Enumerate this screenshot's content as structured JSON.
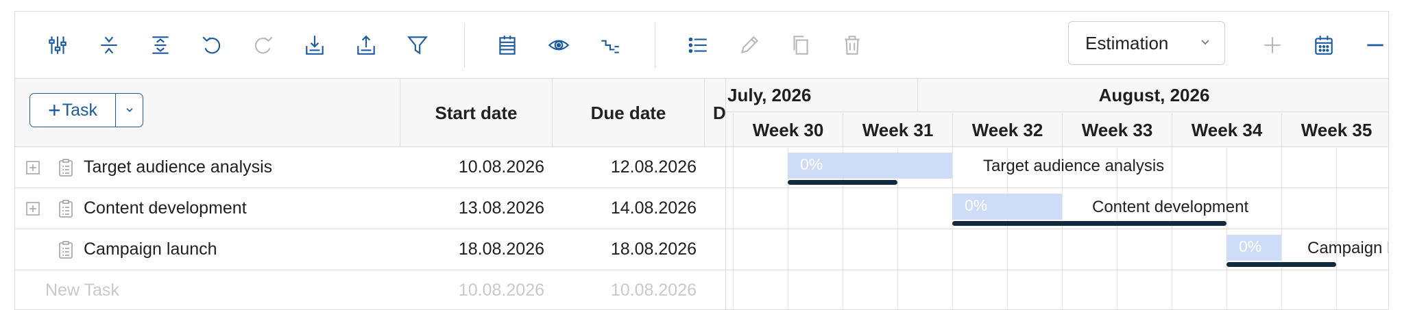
{
  "toolbar": {
    "estimation_select": "Estimation",
    "icons": [
      "column-settings-icon",
      "collapse-all-icon",
      "expand-all-icon",
      "undo-icon",
      "redo-icon",
      "import-icon",
      "export-icon",
      "filter-icon",
      "calendar-grid-icon",
      "eye-icon",
      "critical-path-icon",
      "list-icon",
      "edit-icon",
      "copy-icon",
      "delete-icon",
      "add-icon",
      "calendar-icon",
      "zoom-out-icon"
    ]
  },
  "grid": {
    "add_task_label": "Task",
    "columns": {
      "start": "Start date",
      "due": "Due date",
      "duration_partial": "Du"
    },
    "rows": [
      {
        "name": "Target audience analysis",
        "start": "10.08.2026",
        "due": "12.08.2026",
        "expandable": true
      },
      {
        "name": "Content development",
        "start": "13.08.2026",
        "due": "14.08.2026",
        "expandable": true
      },
      {
        "name": "Campaign launch",
        "start": "18.08.2026",
        "due": "18.08.2026",
        "expandable": false
      }
    ],
    "new_task": {
      "name": "New Task",
      "start": "10.08.2026",
      "due": "10.08.2026"
    }
  },
  "chart": {
    "months": [
      "July, 2026",
      "August, 2026"
    ],
    "weeks": [
      "Week 30",
      "Week 31",
      "Week 32",
      "Week 33",
      "Week 34",
      "Week 35"
    ],
    "bars": [
      {
        "label": "Target audience analysis",
        "percent": "0%"
      },
      {
        "label": "Content development",
        "percent": "0%"
      },
      {
        "label": "Campaign l",
        "percent": "0%"
      }
    ]
  },
  "colors": {
    "accent": "#1a5aa0",
    "bar_fill": "#cfdcf7",
    "progress": "#13293d",
    "disabled": "#b8b8b8"
  }
}
